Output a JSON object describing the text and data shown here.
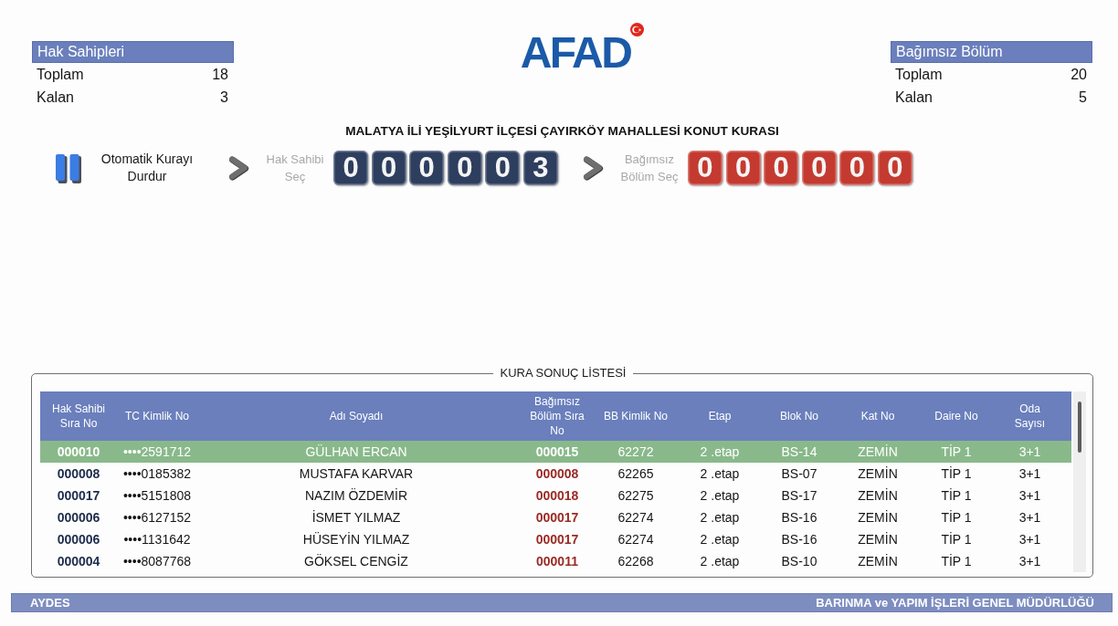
{
  "stat_panels": [
    {
      "title": "Hak Sahipleri",
      "rows": [
        {
          "label": "Toplam",
          "value": "18"
        },
        {
          "label": "Kalan",
          "value": "3"
        }
      ]
    },
    {
      "title": "Bağımsız Bölüm",
      "rows": [
        {
          "label": "Toplam",
          "value": "20"
        },
        {
          "label": "Kalan",
          "value": "5"
        }
      ]
    }
  ],
  "logo": {
    "text": "AFAD"
  },
  "title": "MALATYA İLİ YEŞİLYURT İLÇESİ ÇAYIRKÖY MAHALLESİ KONUT KURASI",
  "draw_controls": {
    "pause_button": {
      "label": "Otomatik Kurayı Durdur"
    },
    "steps": [
      {
        "kind": "owner",
        "label": "Hak Sahibi Seç",
        "disabled": true,
        "digits": [
          "0",
          "0",
          "0",
          "0",
          "0",
          "3"
        ]
      },
      {
        "kind": "unit",
        "label": "Bağımsız Bölüm Seç",
        "disabled": true,
        "digits": [
          "0",
          "0",
          "0",
          "0",
          "0",
          "0"
        ]
      }
    ]
  },
  "results": {
    "legend": "KURA SONUÇ LİSTESİ",
    "columns": [
      "Hak Sahibi Sıra No",
      "TC Kimlik No",
      "Adı Soyadı",
      "Bağımsız Bölüm Sıra No",
      "BB Kimlik No",
      "Etap",
      "Blok No",
      "Kat No",
      "Daire No",
      "Oda Sayısı"
    ],
    "rows": [
      {
        "selected": true,
        "cells": [
          "000010",
          "••••2591712",
          "GÜLHAN ERCAN",
          "000015",
          "62272",
          "2 .etap",
          "BS-14",
          "ZEMİN",
          "TİP 1",
          "3+1"
        ]
      },
      {
        "selected": false,
        "cells": [
          "000008",
          "••••0185382",
          "MUSTAFA KARVAR",
          "000008",
          "62265",
          "2 .etap",
          "BS-07",
          "ZEMİN",
          "TİP 1",
          "3+1"
        ]
      },
      {
        "selected": false,
        "cells": [
          "000017",
          "••••5151808",
          "NAZIM ÖZDEMİR",
          "000018",
          "62275",
          "2 .etap",
          "BS-17",
          "ZEMİN",
          "TİP 1",
          "3+1"
        ]
      },
      {
        "selected": false,
        "cells": [
          "000006",
          "••••6127152",
          "İSMET YILMAZ",
          "000017",
          "62274",
          "2 .etap",
          "BS-16",
          "ZEMİN",
          "TİP 1",
          "3+1"
        ]
      },
      {
        "selected": false,
        "cells": [
          "000006",
          "••••1131642",
          "HÜSEYİN YILMAZ",
          "000017",
          "62274",
          "2 .etap",
          "BS-16",
          "ZEMİN",
          "TİP 1",
          "3+1"
        ]
      },
      {
        "selected": false,
        "cells": [
          "000004",
          "••••8087768",
          "GÖKSEL CENGİZ",
          "000011",
          "62268",
          "2 .etap",
          "BS-10",
          "ZEMİN",
          "TİP 1",
          "3+1"
        ]
      }
    ]
  },
  "footer": {
    "left": "AYDES",
    "right": "BARINMA ve YAPIM İŞLERİ GENEL MÜDÜRLÜĞÜ"
  }
}
